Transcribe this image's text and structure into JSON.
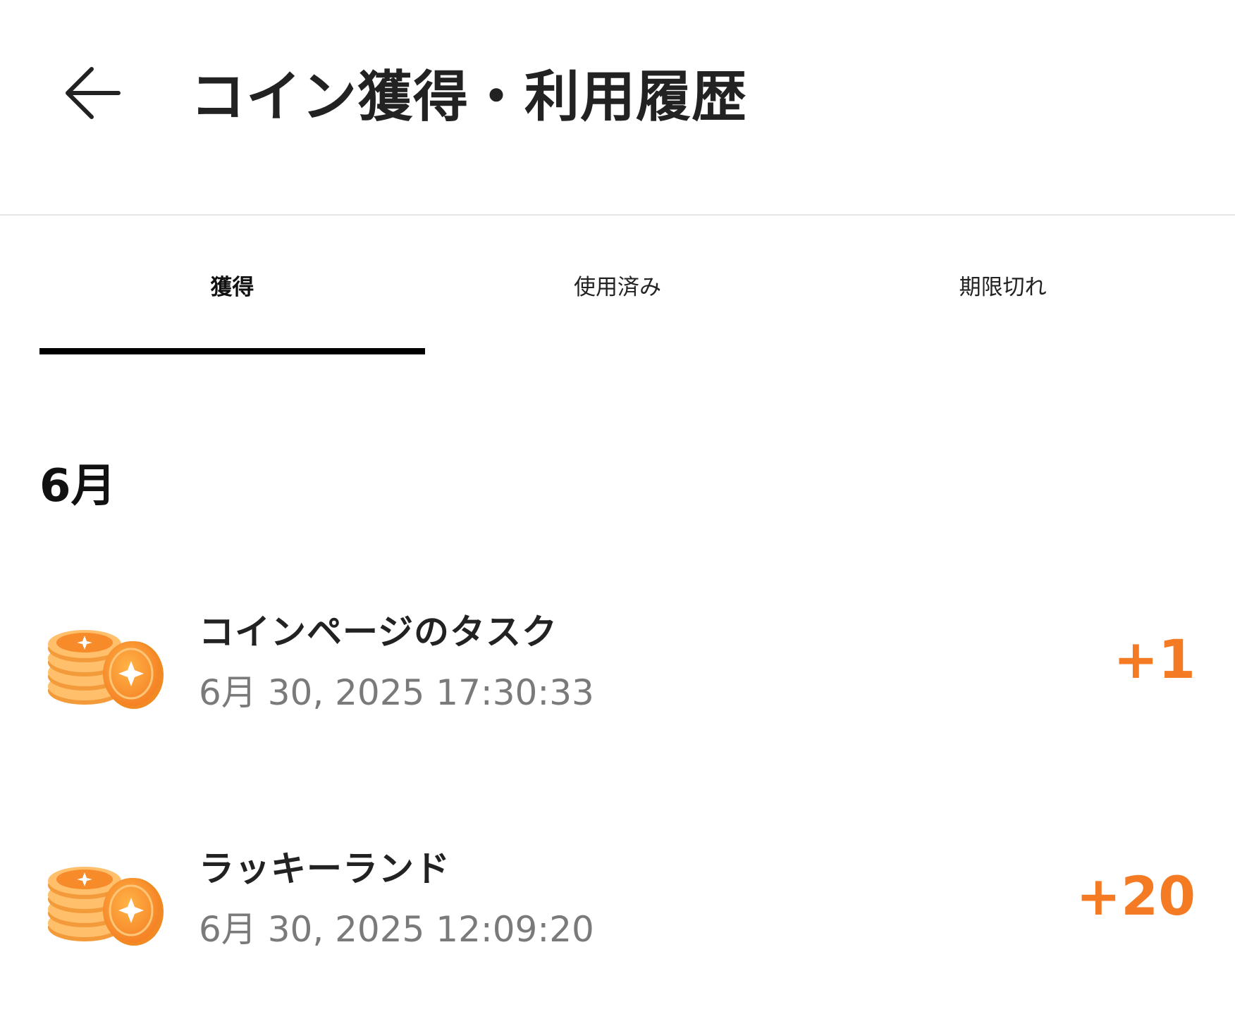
{
  "header": {
    "title": "コイン獲得・利用履歴"
  },
  "tabs": [
    {
      "label": "獲得",
      "active": true
    },
    {
      "label": "使用済み",
      "active": false
    },
    {
      "label": "期限切れ",
      "active": false
    }
  ],
  "history": {
    "month": "6月",
    "records": [
      {
        "title": "コインページのタスク",
        "date": "6月 30, 2025 17:30:33",
        "amount": "+1",
        "icon": "coin-stack-icon"
      },
      {
        "title": "ラッキーランド",
        "date": "6月 30, 2025 12:09:20",
        "amount": "+20",
        "icon": "coin-stack-icon"
      }
    ]
  },
  "colors": {
    "accent_amount": "#f47a24",
    "coin": "#f7931e",
    "text_primary": "#222222",
    "text_secondary": "#7a7a7a",
    "divider": "#e6e6e6"
  }
}
